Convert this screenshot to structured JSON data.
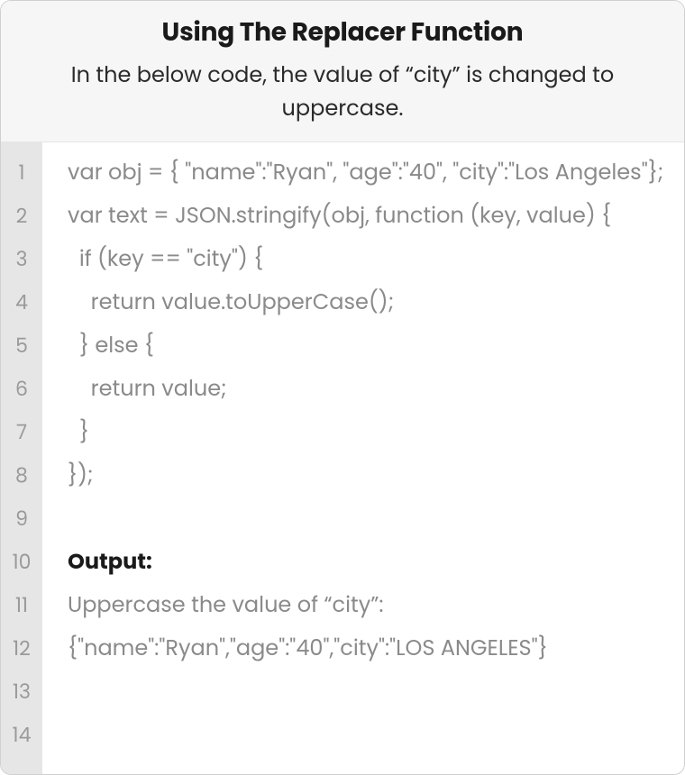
{
  "header": {
    "title": "Using The Replacer Function",
    "subtitle": "In the below code, the value of “city” is changed to uppercase."
  },
  "gutter": {
    "numbers": [
      "1",
      "2",
      "3",
      "4",
      "5",
      "6",
      "7",
      "8",
      "9",
      "10",
      "11",
      "12",
      "13",
      "14"
    ]
  },
  "code": {
    "lines": [
      {
        "text": "var obj = { \"name\":\"Ryan\", \"age\":\"40\", \"city\":\"Los Angeles\"};",
        "bold": false
      },
      {
        "text": "var text = JSON.stringify(obj, function (key, value) {",
        "bold": false
      },
      {
        "text": "  if (key == \"city\") {",
        "bold": false
      },
      {
        "text": "    return value.toUpperCase();",
        "bold": false
      },
      {
        "text": "  } else {",
        "bold": false
      },
      {
        "text": "    return value;",
        "bold": false
      },
      {
        "text": "  }",
        "bold": false
      },
      {
        "text": "});",
        "bold": false
      },
      {
        "text": "",
        "bold": false
      },
      {
        "text": "Output:",
        "bold": true
      },
      {
        "text": "Uppercase the value of “city”:",
        "bold": false
      },
      {
        "text": "{\"name\":\"Ryan\",\"age\":\"40\",\"city\":\"LOS ANGELES\"}",
        "bold": false
      },
      {
        "text": "",
        "bold": false
      },
      {
        "text": "",
        "bold": false
      }
    ]
  }
}
